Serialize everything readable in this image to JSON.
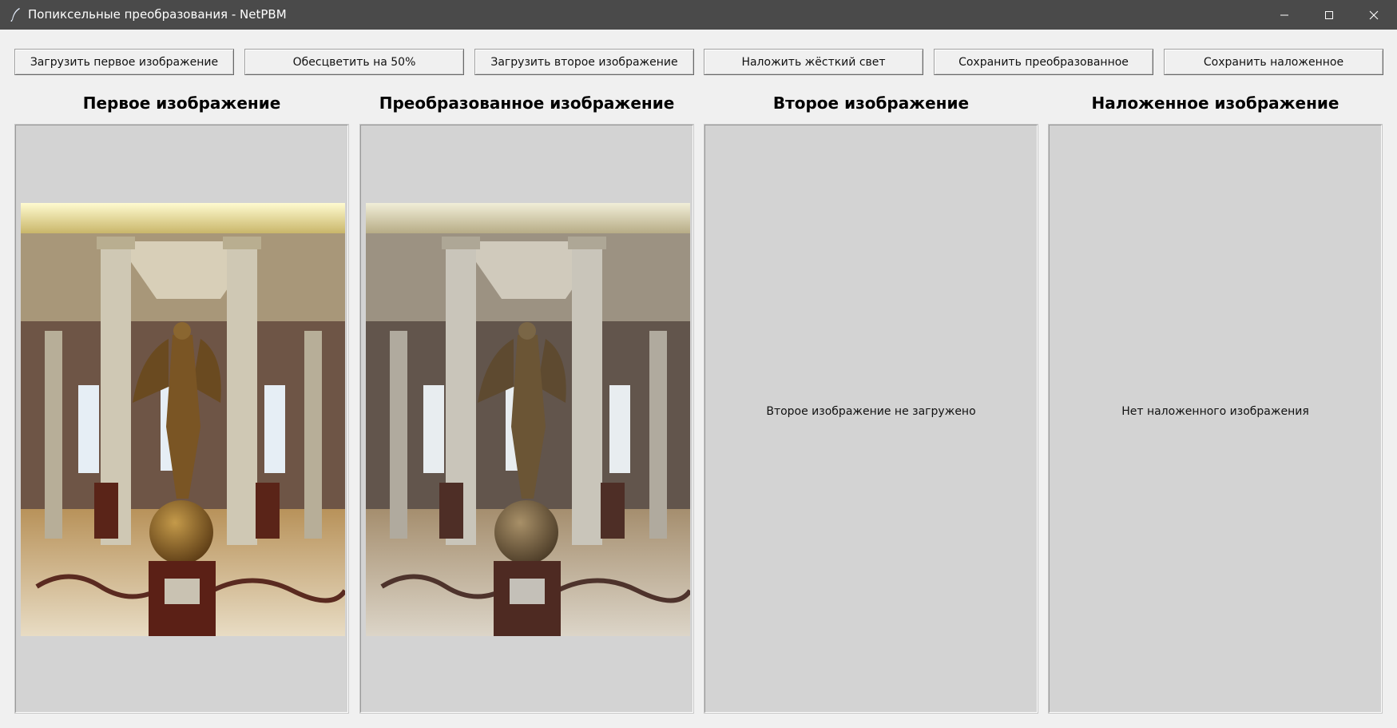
{
  "window": {
    "title": "Попиксельные преобразования - NetPBM",
    "icon": "feather-icon",
    "controls": [
      "minimize-icon",
      "maximize-icon",
      "close-icon"
    ]
  },
  "toolbar": {
    "load_first": "Загрузить первое изображение",
    "desaturate": "Обесцветить на 50%",
    "load_second": "Загрузить второе изображение",
    "hard_light": "Наложить жёсткий свет",
    "save_transformed": "Сохранить преобразованное",
    "save_overlay": "Сохранить наложенное"
  },
  "panels": [
    {
      "title": "Первое изображение",
      "content": "photo-statue-hall"
    },
    {
      "title": "Преобразованное изображение",
      "content": "photo-statue-hall-desaturated"
    },
    {
      "title": "Второе изображение",
      "message": "Второе изображение не загружено"
    },
    {
      "title": "Наложенное изображение",
      "message": "Нет наложенного изображения"
    }
  ],
  "colors": {
    "titlebar": "#4a4a4a",
    "window_bg": "#f0f0f0",
    "panel_bg": "#d3d3d3"
  }
}
